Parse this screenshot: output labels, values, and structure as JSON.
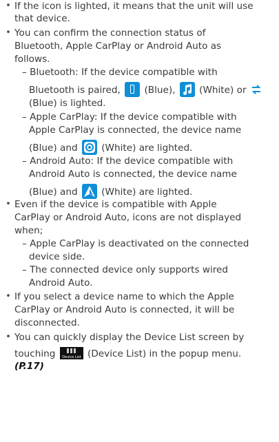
{
  "lines": {
    "l1": "If the icon is lighted, it means that the unit will use",
    "l2": "that device.",
    "l3": "You can confirm the connection status of",
    "l4": "Bluetooth, Apple CarPlay or Android Auto as",
    "l5": "follows.",
    "l6": "– Bluetooth: If the device compatible with",
    "l7a": "Bluetooth is paired,",
    "l7b": "(Blue),",
    "l7c": "(White) or",
    "l8": "(Blue) is lighted.",
    "l9": "– Apple CarPlay: If the device compatible with",
    "l10": "Apple CarPlay is connected, the device name",
    "l11a": "(Blue) and",
    "l11b": "(White) are lighted.",
    "l12": "– Android Auto: If the device compatible with",
    "l13": "Android Auto is connected, the device name",
    "l14a": "(Blue) and",
    "l14b": "(White) are lighted.",
    "l15": "Even if the device is compatible with Apple",
    "l16": "CarPlay or Android Auto, icons are not displayed",
    "l17": "when;",
    "l18": "– Apple CarPlay is deactivated on the connected",
    "l19": "device side.",
    "l20": "– The connected device only supports wired",
    "l21": "Android Auto.",
    "l22": "If you select a device name to which the Apple",
    "l23": "CarPlay or Android Auto is connected, it will be",
    "l24": "disconnected.",
    "l25": "You can quickly display the Device List screen by",
    "l26a": "touching",
    "l26b": "(Device List) in the popup menu.",
    "l27": "(P.17)"
  },
  "icons": {
    "device_list_label": "Device List",
    "blue": "#0f8fd8",
    "bullet": "•"
  }
}
